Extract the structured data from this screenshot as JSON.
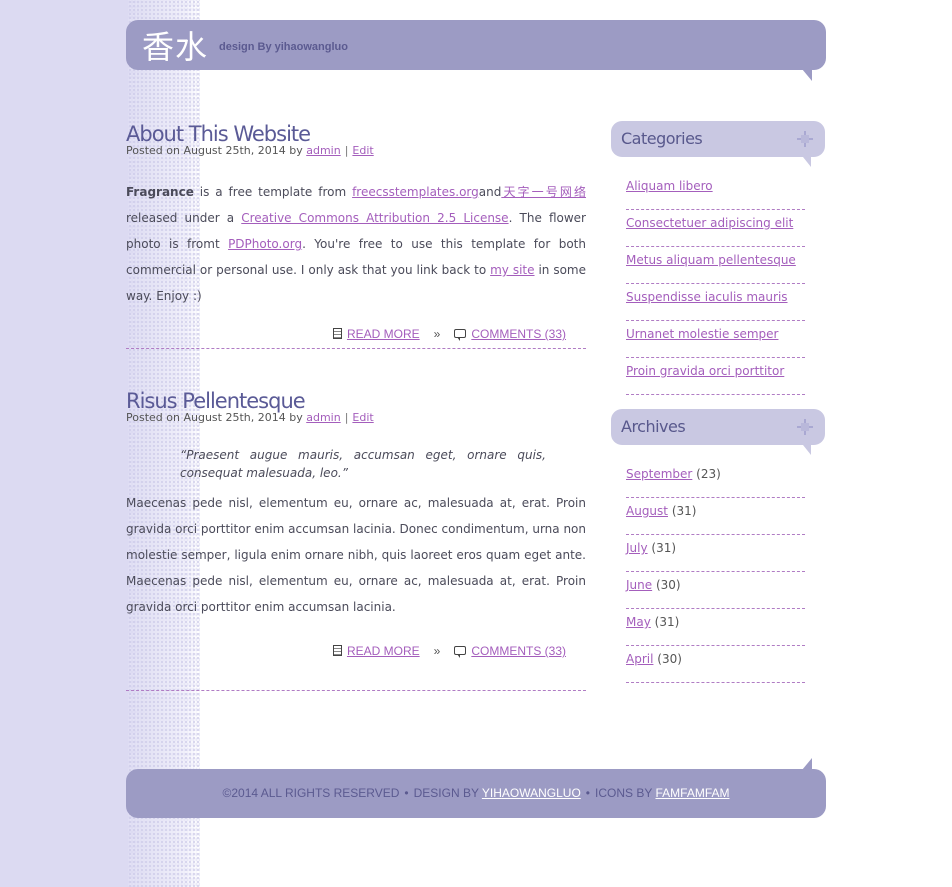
{
  "header": {
    "logo": "香水",
    "tagline": "design By yihaowangluo"
  },
  "posts": [
    {
      "title": "About This Website",
      "meta_prefix": "Posted on August 25th, 2014 by",
      "author": "admin",
      "edit": "Edit",
      "entry": {
        "word1": "Fragrance",
        "t1": " is a free template from ",
        "link1": "freecsstemplates.org",
        "t2": "and",
        "link2": "天字一号网络",
        "t3": " released under a ",
        "link3": "Creative Commons Attribution 2.5 License",
        "t4": ". The flower photo is fromt ",
        "link4": "PDPhoto.org",
        "t5": ". You're free to use this template for both commercial or personal use. I only ask that you link back to ",
        "link5": "my site",
        "t6": " in some way. Enjoy :)"
      },
      "read_more": "READ MORE",
      "raquo": "»",
      "comments": "COMMENTS (33)"
    },
    {
      "title": "Risus Pellentesque",
      "meta_prefix": "Posted on August 25th, 2014 by",
      "author": "admin",
      "edit": "Edit",
      "quote": "“Praesent augue mauris, accumsan eget, ornare quis, consequat malesuada, leo.”",
      "body": "Maecenas pede nisl, elementum eu, ornare ac, malesuada at, erat. Proin gravida orci porttitor enim accumsan lacinia. Donec condimentum, urna non molestie semper, ligula enim ornare nibh, quis laoreet eros quam eget ante. Maecenas pede nisl, elementum eu, ornare ac, malesuada at, erat. Proin gravida orci porttitor enim accumsan lacinia.",
      "read_more": "READ MORE",
      "raquo": "»",
      "comments": "COMMENTS (33)"
    }
  ],
  "sidebar": {
    "categories_title": "Categories",
    "categories": [
      "Aliquam libero",
      "Consectetuer adipiscing elit",
      "Metus aliquam pellentesque",
      "Suspendisse iaculis mauris",
      "Urnanet molestie semper",
      "Proin gravida orci porttitor"
    ],
    "archives_title": "Archives",
    "archives": [
      {
        "month": "September",
        "count": "(23)"
      },
      {
        "month": "August",
        "count": "(31)"
      },
      {
        "month": "July",
        "count": "(31)"
      },
      {
        "month": "June",
        "count": "(30)"
      },
      {
        "month": "May",
        "count": "(31)"
      },
      {
        "month": "April",
        "count": "(30)"
      }
    ]
  },
  "footer": {
    "copyright": "©2014 ALL RIGHTS RESERVED",
    "bullet": "•",
    "design_by": "DESIGN BY",
    "designer": "YIHAOWANGLUO",
    "icons_by": "ICONS BY",
    "icons_author": "FAMFAMFAM"
  }
}
